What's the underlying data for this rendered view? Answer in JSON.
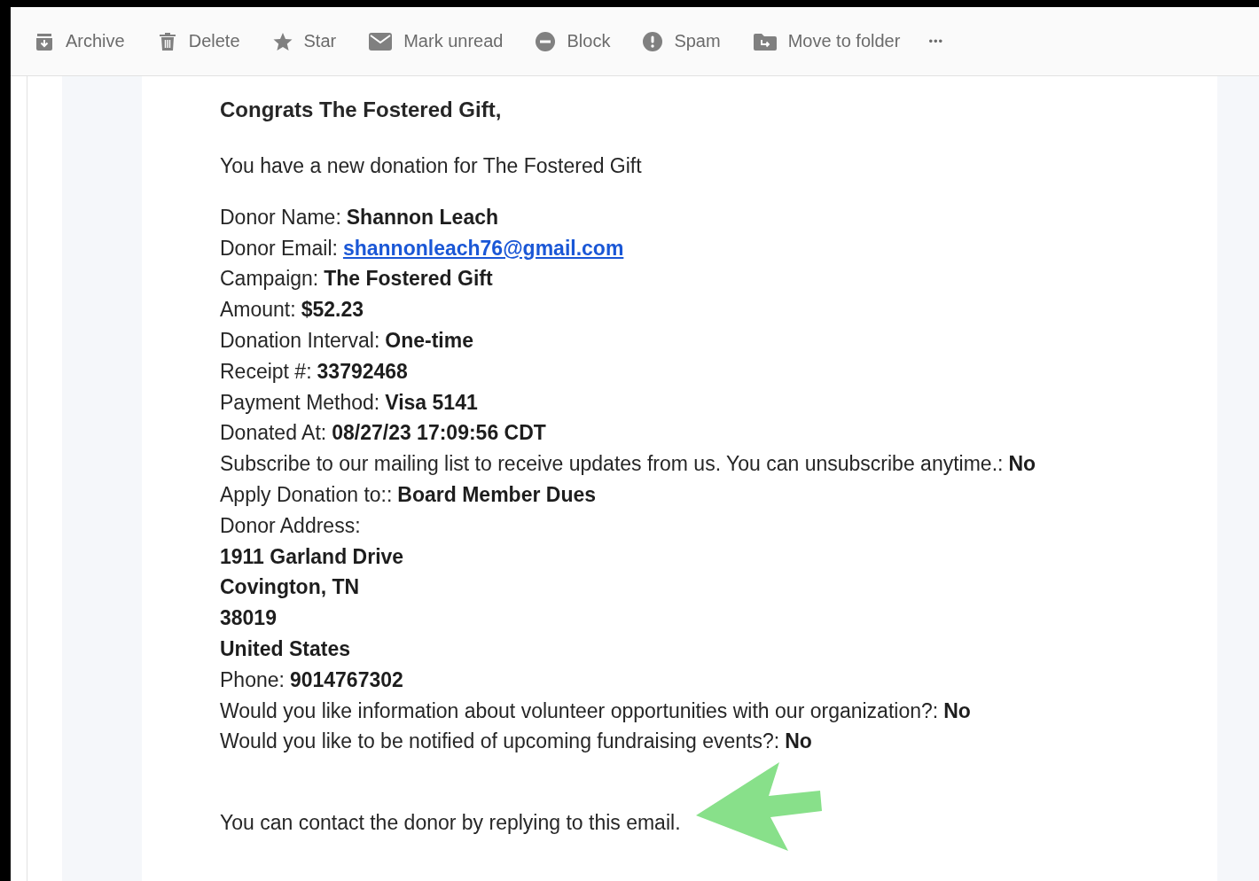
{
  "toolbar": [
    {
      "label": "Archive"
    },
    {
      "label": "Delete"
    },
    {
      "label": "Star"
    },
    {
      "label": "Mark unread"
    },
    {
      "label": "Block"
    },
    {
      "label": "Spam"
    },
    {
      "label": "Move to folder"
    },
    {
      "label": "•••"
    }
  ],
  "email": {
    "greeting": "Congrats The Fostered Gift,",
    "intro": "You have a new donation for The Fostered Gift",
    "details": [
      {
        "kind": "text",
        "label": "Donor Name:",
        "value": "Shannon Leach"
      },
      {
        "kind": "link",
        "label": "Donor Email:",
        "value": "shannonleach76@gmail.com"
      },
      {
        "kind": "text",
        "label": "Campaign:",
        "value": "The Fostered Gift"
      },
      {
        "kind": "text",
        "label": "Amount:",
        "value": "$52.23"
      },
      {
        "kind": "text",
        "label": "Donation Interval:",
        "value": "One-time"
      },
      {
        "kind": "text",
        "label": "Receipt #:",
        "value": "33792468"
      },
      {
        "kind": "text",
        "label": "Payment Method:",
        "value": "Visa 5141"
      },
      {
        "kind": "text",
        "label": "Donated At:",
        "value": "08/27/23 17:09:56 CDT"
      },
      {
        "kind": "text",
        "label": "Subscribe to our mailing list to receive updates from us. You can unsubscribe anytime.:",
        "value": "No"
      },
      {
        "kind": "text",
        "label": "Apply Donation to::",
        "value": "Board Member Dues"
      },
      {
        "kind": "label",
        "label": "Donor Address:"
      },
      {
        "kind": "bold",
        "value": "1911 Garland Drive"
      },
      {
        "kind": "bold",
        "value": "Covington, TN"
      },
      {
        "kind": "bold",
        "value": "38019"
      },
      {
        "kind": "bold",
        "value": "United States"
      },
      {
        "kind": "text",
        "label": "Phone:",
        "value": "9014767302"
      },
      {
        "kind": "text",
        "label": "Would you like information about volunteer opportunities with our organization?:",
        "value": "No"
      },
      {
        "kind": "text",
        "label": "Would you like to be notified of upcoming fundraising events?:",
        "value": "No"
      }
    ],
    "closing": "You can contact the donor by replying to this email."
  }
}
